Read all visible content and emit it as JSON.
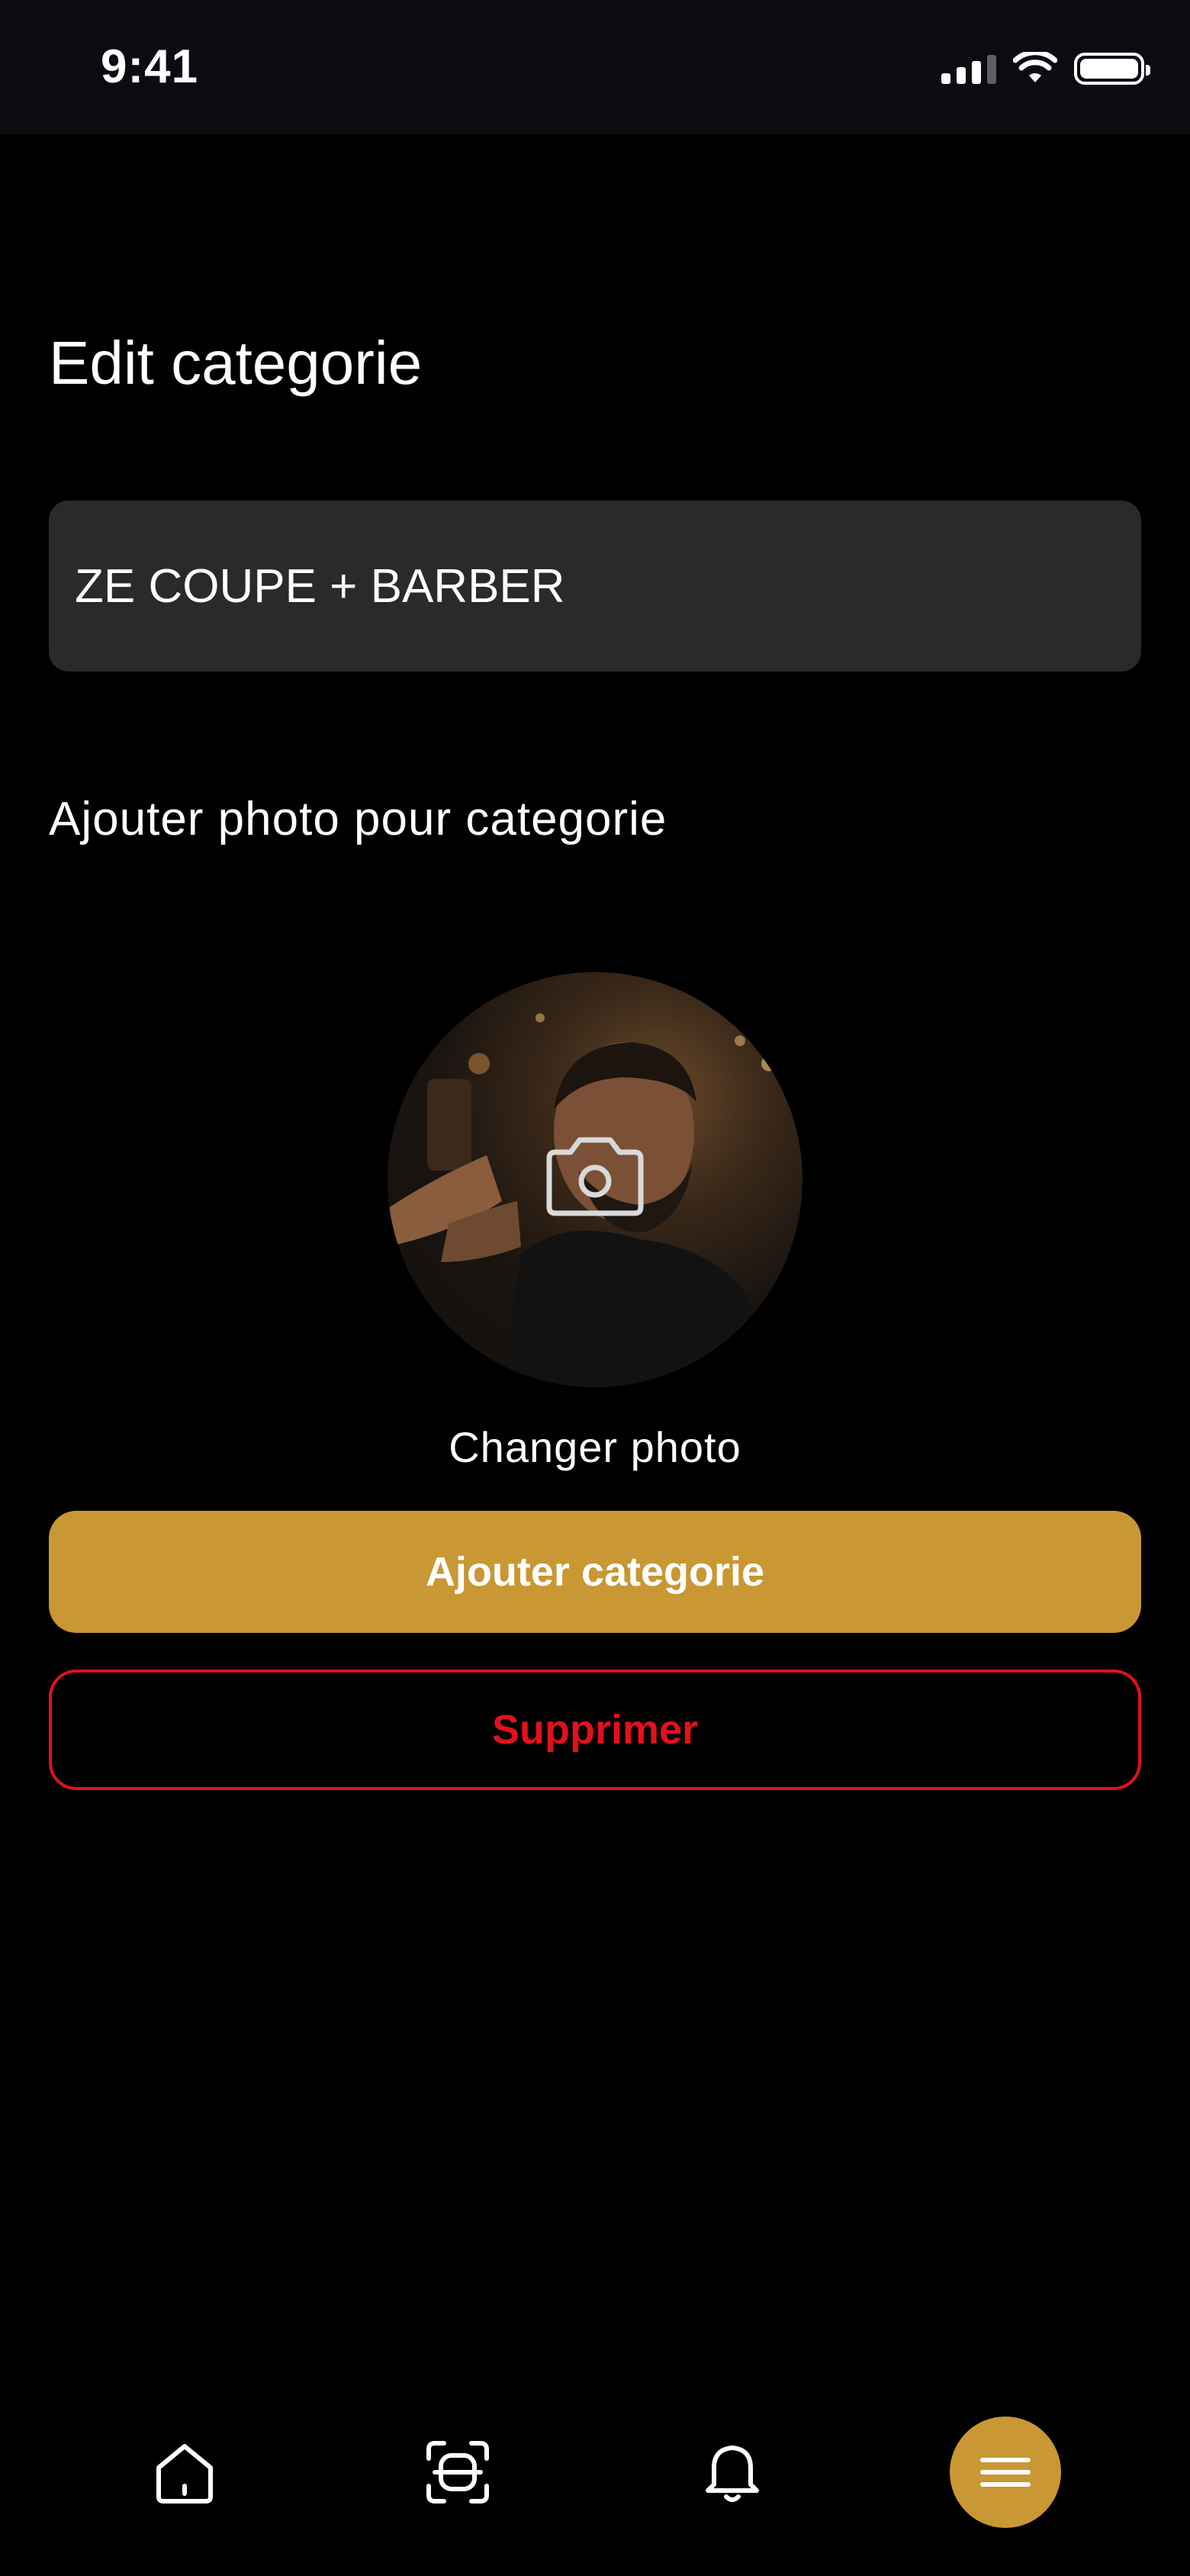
{
  "status_bar": {
    "time": "9:41",
    "icons": [
      "cellular-signal-icon",
      "wifi-icon",
      "battery-icon"
    ]
  },
  "page": {
    "title": "Edit categorie"
  },
  "form": {
    "name_value": "ZE COUPE + BARBER",
    "photo_label": "Ajouter photo pour categorie",
    "change_photo_label": "Changer photo",
    "submit_label": "Ajouter categorie",
    "delete_label": "Supprimer"
  },
  "tab_bar": {
    "items": [
      {
        "icon": "home-icon"
      },
      {
        "icon": "scan-icon"
      },
      {
        "icon": "bell-icon"
      },
      {
        "icon": "menu-icon",
        "active": true
      }
    ]
  },
  "colors": {
    "background": "#000000",
    "accent": "#c99733",
    "danger": "#e0121b",
    "input_background": "#2a2a2a"
  }
}
